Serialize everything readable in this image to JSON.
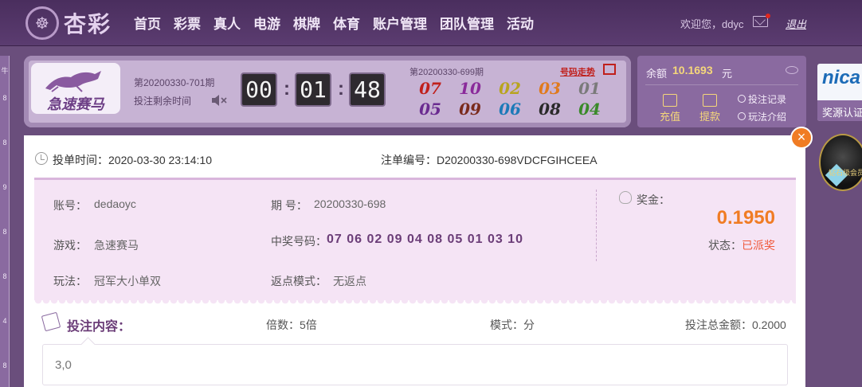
{
  "header": {
    "logo_text": "杏彩",
    "nav": [
      "首页",
      "彩票",
      "真人",
      "电游",
      "棋牌",
      "体育",
      "账户管理",
      "团队管理",
      "活动"
    ],
    "welcome": "欢迎您，ddyc",
    "logout": "退出"
  },
  "sidebar": {
    "digits": [
      "牛",
      "8",
      "8",
      "9",
      "8",
      "8",
      "4",
      "8"
    ]
  },
  "game": {
    "name": "急速赛马",
    "current_issue": "第20200330-701期",
    "remaining_label": "投注剩余时间",
    "countdown": [
      "00",
      "01",
      "48"
    ],
    "last_issue": "第20200330-699期",
    "trend_link": "号码走势",
    "last_numbers": [
      {
        "n": "07",
        "color": "#c0201c"
      },
      {
        "n": "10",
        "color": "#8a2a9a"
      },
      {
        "n": "02",
        "color": "#b8a41e"
      },
      {
        "n": "03",
        "color": "#e07a1c"
      },
      {
        "n": "01",
        "color": "#7a7a7a"
      },
      {
        "n": "05",
        "color": "#6a2a90"
      },
      {
        "n": "09",
        "color": "#7a2a1c"
      },
      {
        "n": "06",
        "color": "#1c7ab8"
      },
      {
        "n": "08",
        "color": "#2a2a2a"
      },
      {
        "n": "04",
        "color": "#3a8a2a"
      }
    ]
  },
  "account": {
    "balance_label": "余额",
    "balance": "10.1693",
    "unit": "元",
    "deposit": "充值",
    "withdraw": "提款",
    "bet_record": "投注记录",
    "rules": "玩法介绍"
  },
  "promo": {
    "logo": "nica",
    "label": "奖源认证",
    "badge": "钻石级会员"
  },
  "modal": {
    "close": "×",
    "bet_time_label": "投单时间：",
    "bet_time": "2020-03-30 23:14:10",
    "bet_no_label": "注单编号：",
    "bet_no": "D20200330-698VDCFGIHCEEA",
    "account_label": "账号：",
    "account": "dedaoyc",
    "issue_label": "期 号：",
    "issue": "20200330-698",
    "game_label": "游戏：",
    "game": "急速赛马",
    "win_label": "中奖号码：",
    "win_numbers": "07 06 02 09 04 08 05 01 03 10",
    "play_label": "玩法：",
    "play": "冠军大小单双",
    "rebate_label": "返点模式：",
    "rebate": "无返点",
    "prize_label": "奖金：",
    "prize": "0.1950",
    "status_label": "状态：",
    "status": "已派奖",
    "content_title": "投注内容：",
    "multiple_label": "倍数：",
    "multiple": "5倍",
    "mode_label": "模式：",
    "mode": "分",
    "total_label": "投注总金额：",
    "total": "0.2000",
    "content": "3,0"
  }
}
